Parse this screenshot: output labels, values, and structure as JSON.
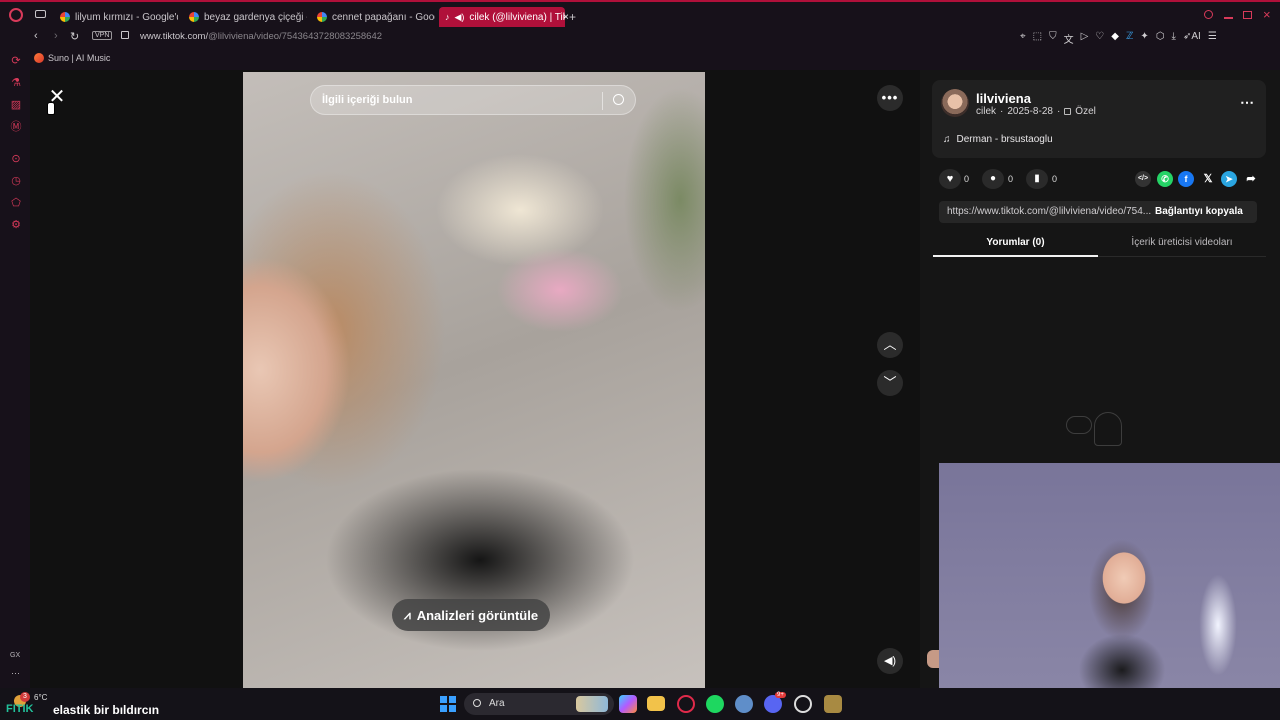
{
  "browser": {
    "tabs": [
      {
        "label": "lilyum kırmızı - Google'da"
      },
      {
        "label": "beyaz gardenya çiçeği - G"
      },
      {
        "label": "cennet papağanı - Google"
      },
      {
        "label": "cilek (@lilviviena) | Tik"
      }
    ],
    "new_tab_label": "+",
    "vpn_badge": "VPN",
    "url_host": "www.tiktok.com/",
    "url_path": "@lilviviena/video/7543643728083258642",
    "ai_label": "AI",
    "bookmark_label": "Suno | AI Music",
    "sidebar_bottom_label": "GX",
    "accent_color": "#b0103a"
  },
  "video": {
    "search_placeholder": "İlgili içeriği bulun",
    "analyze_label": "Analizleri görüntüle"
  },
  "post": {
    "username": "lilviviena",
    "display_name": "cilek",
    "date": "2025-8-28",
    "privacy_label": "Özel",
    "sound": "Derman - brsustaoglu",
    "likes": "0",
    "comments": "0",
    "saves": "0",
    "link_value": "https://www.tiktok.com/@lilviviena/video/754...",
    "copy_link_label": "Bağlantıyı kopyala",
    "tabs": [
      {
        "label": "Yorumlar (0)",
        "active": true
      },
      {
        "label": "İçerik üreticisi videoları",
        "active": false
      }
    ]
  },
  "taskbar": {
    "weather_temp": "6°C",
    "notification_count": "3",
    "marquee_text": "elastik bir bıldırcın",
    "marquee_prefix": "FITIK",
    "search_label": "Ara",
    "discord_badge": "9+"
  },
  "icons": [
    "opera-logo",
    "close-icon",
    "more-icon",
    "chevron-up-icon",
    "chevron-down-icon",
    "volume-icon",
    "search-icon",
    "heart-icon",
    "comment-icon",
    "bookmark-icon",
    "embed-icon",
    "whatsapp-icon",
    "facebook-icon",
    "x-icon",
    "telegram-icon",
    "share-icon",
    "music-note-icon",
    "lock-icon",
    "chart-icon"
  ]
}
